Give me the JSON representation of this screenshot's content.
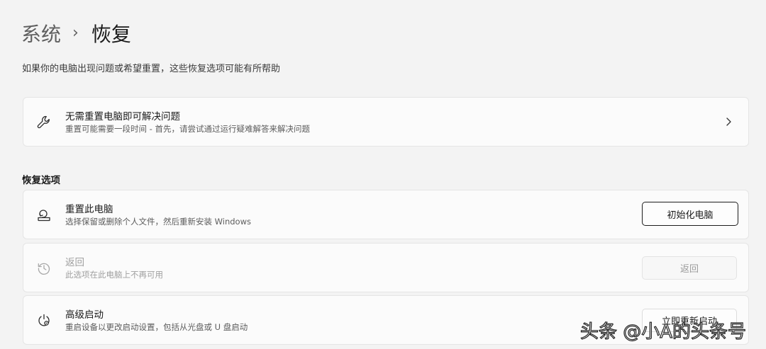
{
  "breadcrumb": {
    "parent": "系统",
    "separator": "›",
    "current": "恢复"
  },
  "subtitle": "如果你的电脑出现问题或希望重置，这些恢复选项可能有所帮助",
  "troubleshoot": {
    "icon": "wrench-icon",
    "title": "无需重置电脑即可解决问题",
    "description": "重置可能需要一段时间 - 首先，请尝试通过运行疑难解答来解决问题",
    "chevron_icon": "chevron-right-icon"
  },
  "recovery_options": {
    "heading": "恢复选项",
    "items": [
      {
        "icon": "reset-pc-icon",
        "title": "重置此电脑",
        "description": "选择保留或删除个人文件，然后重新安装 Windows",
        "button_label": "初始化电脑",
        "enabled": true
      },
      {
        "icon": "history-icon",
        "title": "返回",
        "description": "此选项在此电脑上不再可用",
        "button_label": "返回",
        "enabled": false
      },
      {
        "icon": "advanced-startup-icon",
        "title": "高级启动",
        "description": "重启设备以更改启动设置，包括从光盘或 U 盘启动",
        "button_label": "立即重新启动",
        "enabled": true
      }
    ]
  },
  "watermark": "头条 @小A的头条号"
}
